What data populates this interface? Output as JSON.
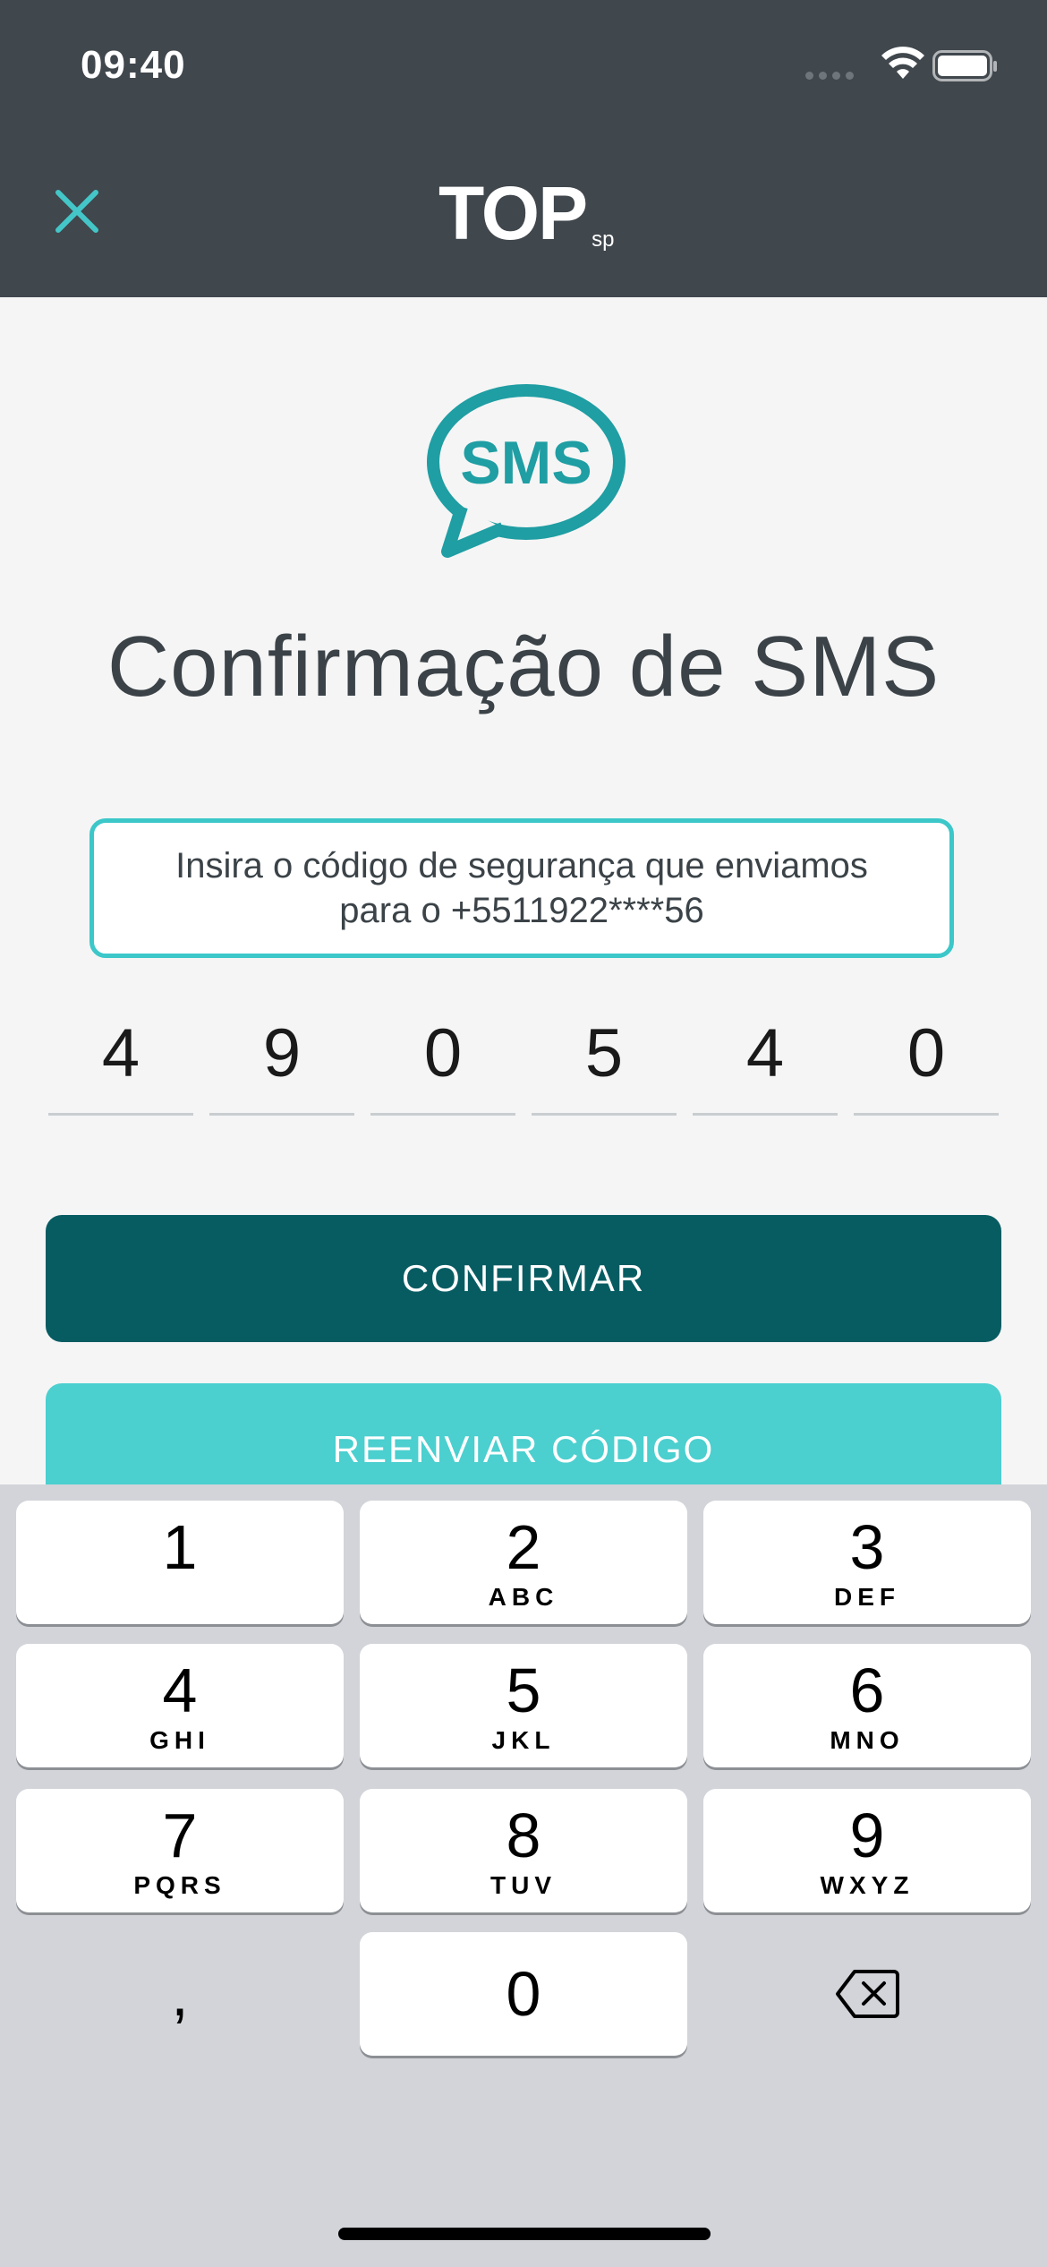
{
  "status_bar": {
    "time": "09:40"
  },
  "header": {
    "logo_main": "TOP",
    "logo_sub": "sp"
  },
  "sms_icon": {
    "label": "SMS"
  },
  "title": "Confirmação de SMS",
  "info": {
    "line1": "Insira o código de segurança que enviamos",
    "line2": "para o +5511922****56"
  },
  "code_digits": [
    "4",
    "9",
    "0",
    "5",
    "4",
    "0"
  ],
  "buttons": {
    "confirm": "CONFIRMAR",
    "resend": "REENVIAR CÓDIGO"
  },
  "keyboard": {
    "keys": [
      {
        "digit": "1",
        "letters": ""
      },
      {
        "digit": "2",
        "letters": "ABC"
      },
      {
        "digit": "3",
        "letters": "DEF"
      },
      {
        "digit": "4",
        "letters": "GHI"
      },
      {
        "digit": "5",
        "letters": "JKL"
      },
      {
        "digit": "6",
        "letters": "MNO"
      },
      {
        "digit": "7",
        "letters": "PQRS"
      },
      {
        "digit": "8",
        "letters": "TUV"
      },
      {
        "digit": "9",
        "letters": "WXYZ"
      },
      {
        "digit": "0",
        "letters": ""
      }
    ],
    "comma": ","
  },
  "colors": {
    "header_bg": "#40474d",
    "accent": "#3cc7c9",
    "confirm_bg": "#075c62",
    "resend_bg": "#4bcfcf"
  }
}
